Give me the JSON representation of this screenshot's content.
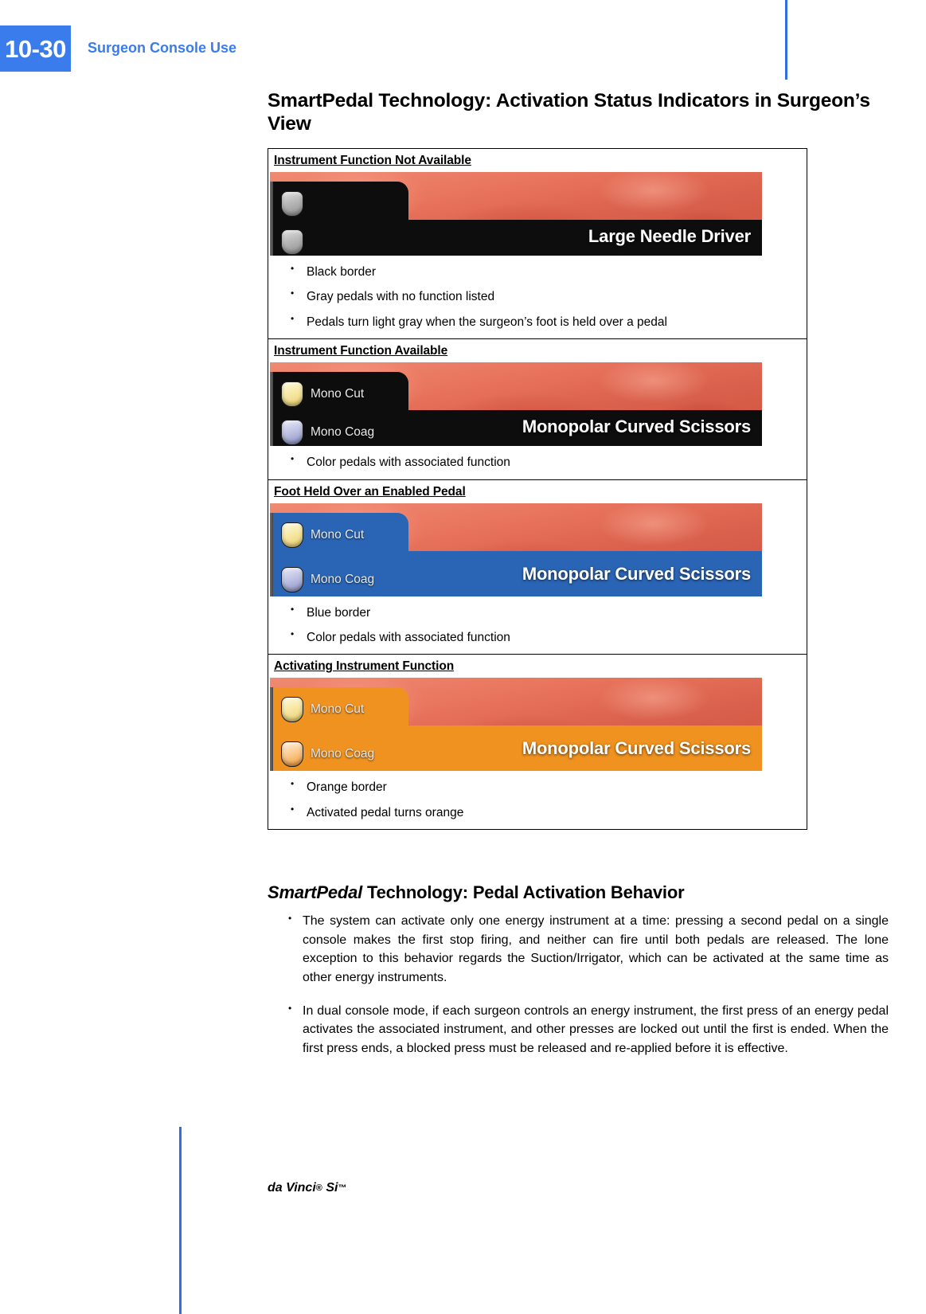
{
  "header": {
    "page_number": "10-30",
    "running_head": "Surgeon Console Use",
    "accent_color": "#3b7cec"
  },
  "title": "SmartPedal Technology: Activation Status Indicators in Surgeon’s View",
  "status_table": {
    "bands": [
      {
        "heading": "Instrument Function Not Available",
        "border_state": "black",
        "border_color": "#0d0d0d",
        "instrument_name": "Large Needle Driver",
        "pedals": [
          {
            "label": "",
            "color_name": "gray",
            "color": "#b8b8b8"
          },
          {
            "label": "",
            "color_name": "gray",
            "color": "#b8b8b8"
          }
        ],
        "bullets": [
          "Black border",
          "Gray pedals with no function listed",
          "Pedals turn light gray when the surgeon’s foot is held over a pedal"
        ]
      },
      {
        "heading": "Instrument Function Available",
        "border_state": "black",
        "border_color": "#0d0d0d",
        "instrument_name": "Monopolar Curved Scissors",
        "pedals": [
          {
            "label": "Mono Cut",
            "color_name": "yellow",
            "color": "#f7e9a6"
          },
          {
            "label": "Mono Coag",
            "color_name": "lavender",
            "color": "#bcc0e2"
          }
        ],
        "bullets": [
          "Color pedals with associated function"
        ]
      },
      {
        "heading": "Foot Held Over an Enabled Pedal",
        "border_state": "blue",
        "border_color": "#2a65b5",
        "instrument_name": "Monopolar Curved Scissors",
        "pedals": [
          {
            "label": "Mono Cut",
            "color_name": "yellow",
            "color": "#f7e9a6"
          },
          {
            "label": "Mono Coag",
            "color_name": "lavender",
            "color": "#bcc0e2"
          }
        ],
        "bullets": [
          "Blue border",
          "Color pedals with associated function"
        ]
      },
      {
        "heading": "Activating Instrument Function",
        "border_state": "orange",
        "border_color": "#f0921f",
        "instrument_name": "Monopolar Curved Scissors",
        "pedals": [
          {
            "label": "Mono Cut",
            "color_name": "yellow",
            "color": "#f7e9a6"
          },
          {
            "label": "Mono Coag",
            "color_name": "orange",
            "color": "#fbc98a"
          }
        ],
        "bullets": [
          "Orange border",
          "Activated pedal turns orange"
        ]
      }
    ]
  },
  "behavior_section": {
    "title_italic_part": "SmartPedal",
    "title_rest": " Technology: Pedal Activation Behavior",
    "bullets": [
      "The system can activate only one energy instrument at a time: pressing a second pedal on a single console makes the first stop firing, and neither can fire until both pedals are released. The lone exception to this behavior regards the Suction/Irrigator, which can be activated at the same time as other energy instruments.",
      "In dual console mode, if each surgeon controls an energy instrument, the first press of an energy pedal activates the associated instrument, and other presses are locked out until the first is ended. When the first press ends, a blocked press must be released and re-applied before it is effective."
    ]
  },
  "footer": {
    "product": "da Vinci",
    "registered_mark": "®",
    "model": " Si",
    "trademark": "™"
  }
}
